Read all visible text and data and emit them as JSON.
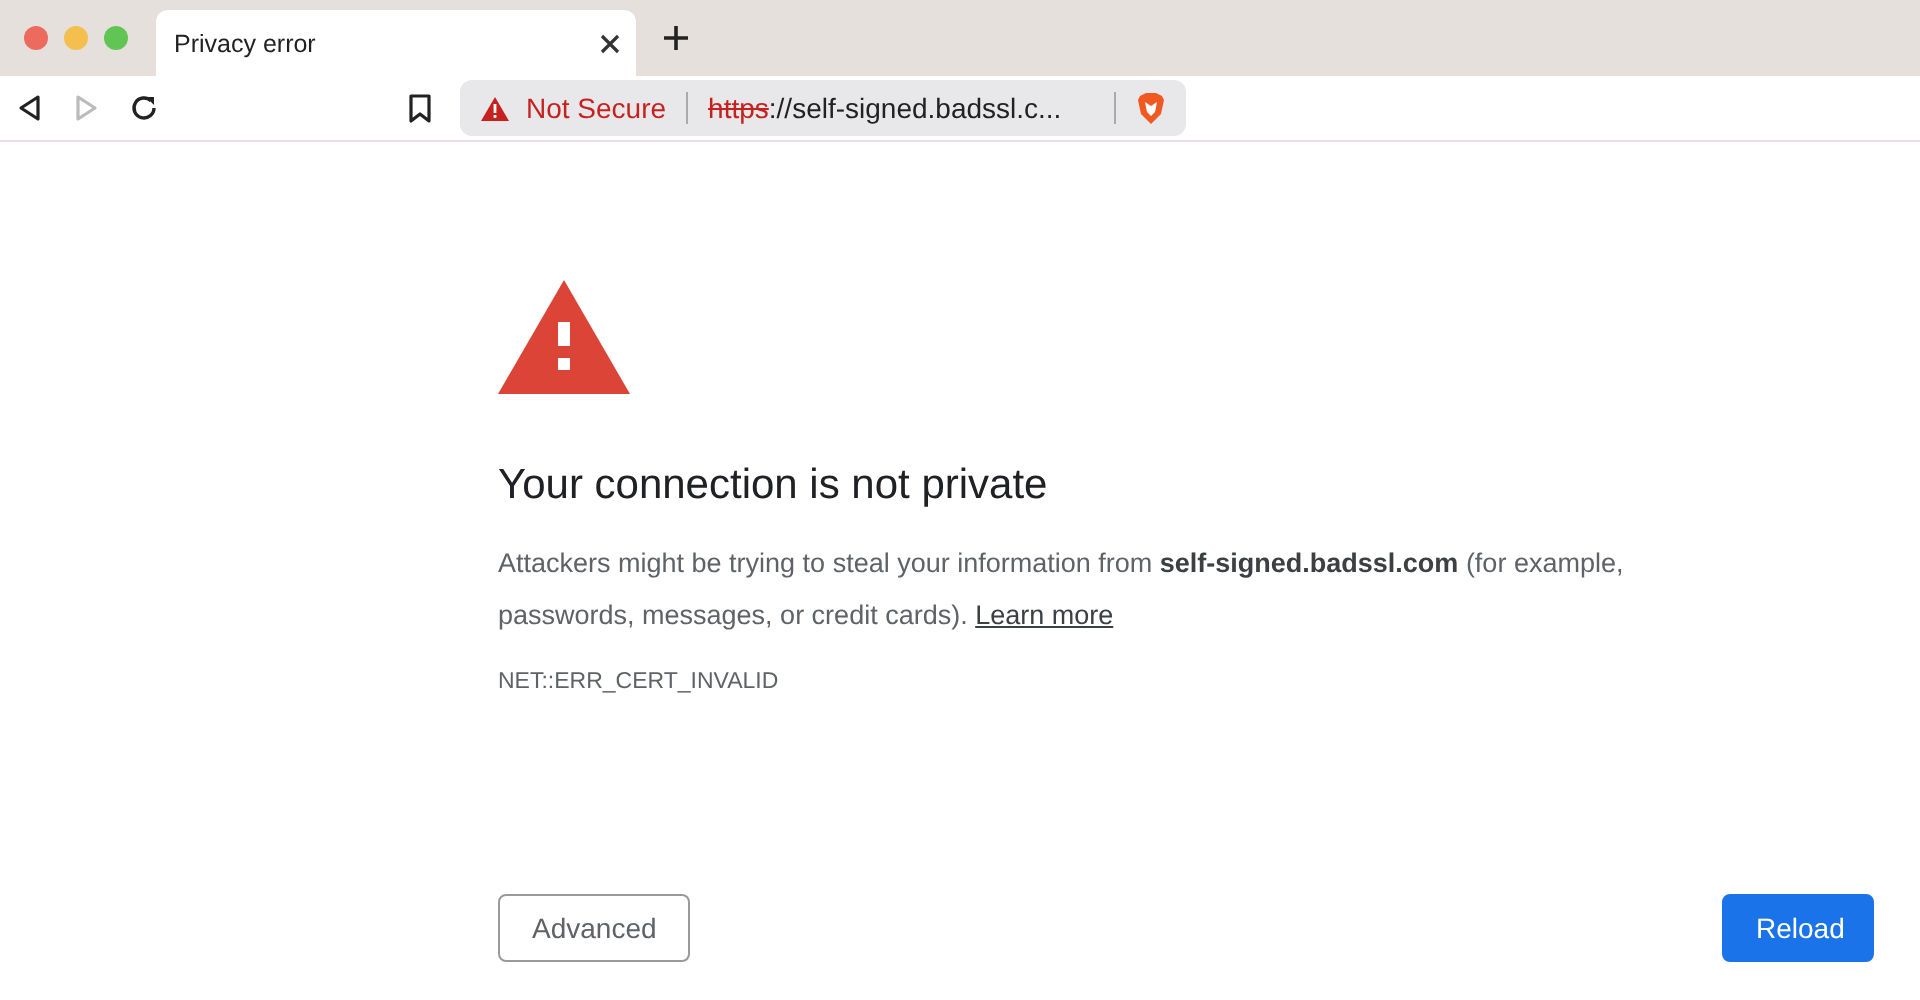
{
  "tab": {
    "title": "Privacy error",
    "selected": true
  },
  "address_bar": {
    "security": "Not Secure",
    "scheme": "https",
    "url": "://self-signed.badssl.c..."
  },
  "toolbar": {
    "forward_disabled": true
  },
  "error": {
    "heading": "Your connection is not private",
    "message": "Attackers might be trying to steal your information from **self-signed.badssl.com** (for example, passwords, messages, or credit cards).",
    "link": "Learn more",
    "code": "NET::ERR_CERT_INVALID"
  },
  "buttons": [
    {
      "label": "Advanced",
      "kind": "secondary"
    },
    {
      "label": "Reload",
      "kind": "primary"
    }
  ]
}
